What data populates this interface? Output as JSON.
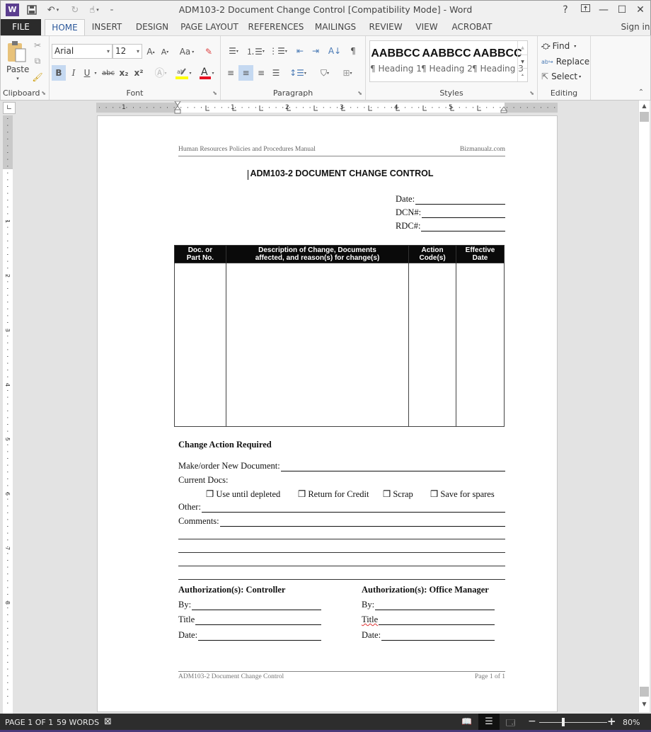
{
  "window": {
    "title": "ADM103-2 Document Change Control [Compatibility Mode] - Word",
    "controls": {
      "help": "?",
      "ribbon_options": "⊼",
      "minimize": "—",
      "maximize": "☐",
      "close": "✕"
    }
  },
  "quick_access": {
    "app_icon": "W",
    "save_icon": "save-icon",
    "undo_icon": "undo-icon",
    "redo_icon": "redo-icon",
    "touch_mode_icon": "touch-mode-icon",
    "customize_icon": "customize-icon"
  },
  "ribbon_tabs": [
    {
      "label": "FILE"
    },
    {
      "label": "HOME",
      "active": true
    },
    {
      "label": "INSERT"
    },
    {
      "label": "DESIGN"
    },
    {
      "label": "PAGE LAYOUT"
    },
    {
      "label": "REFERENCES"
    },
    {
      "label": "MAILINGS"
    },
    {
      "label": "REVIEW"
    },
    {
      "label": "VIEW"
    },
    {
      "label": "ACROBAT"
    }
  ],
  "sign_in": "Sign in",
  "ribbon": {
    "clipboard": {
      "label": "Clipboard",
      "paste": "Paste"
    },
    "font": {
      "label": "Font",
      "family": "Arial",
      "size": "12",
      "change_case": "Aa",
      "bold": "B",
      "italic": "I",
      "underline": "U",
      "strikethrough": "abc",
      "subscript": "x₂",
      "superscript": "x²",
      "highlight_color": "#ffff00",
      "font_color": "#e81123"
    },
    "paragraph": {
      "label": "Paragraph",
      "pilcrow": "¶"
    },
    "styles": {
      "label": "Styles",
      "items": [
        {
          "preview": "AABBCC",
          "name": "¶ Heading 1"
        },
        {
          "preview": "AABBCC",
          "name": "¶ Heading 2"
        },
        {
          "preview": "AABBCC",
          "name": "¶ Heading 3"
        }
      ]
    },
    "editing": {
      "label": "Editing",
      "find": "Find",
      "replace": "Replace",
      "select": "Select"
    }
  },
  "ruler": {
    "horizontal_numbers": [
      "1",
      "1",
      "2",
      "3",
      "4",
      "5"
    ],
    "vertical_numbers": [
      "1",
      "2",
      "3",
      "4",
      "5",
      "6",
      "7",
      "8"
    ]
  },
  "document": {
    "header_left": "Human Resources Policies and Procedures Manual",
    "header_right": "Bizmanualz.com",
    "title": "ADM103-2 DOCUMENT CHANGE CONTROL",
    "top_fields": [
      "Date:",
      "DCN#:",
      "RDC#:"
    ],
    "table": {
      "headers": [
        [
          "Doc. or",
          "Part No."
        ],
        [
          "Description of Change, Documents",
          "affected, and reason(s) for change(s)"
        ],
        [
          "Action",
          "Code(s)"
        ],
        [
          "Effective",
          "Date"
        ]
      ]
    },
    "change_action": {
      "heading": "Change Action Required",
      "make_order": "Make/order New Document:",
      "current_docs": "Current Docs:",
      "checkboxes": [
        {
          "label": "Use until depleted",
          "checked": false
        },
        {
          "label": "Return for Credit",
          "checked": false
        },
        {
          "label": "Scrap",
          "checked": false
        },
        {
          "label": "Save for spares",
          "checked": false
        }
      ],
      "other": "Other:",
      "comments": "Comments:"
    },
    "authorization": [
      {
        "heading": "Authorization(s): Controller",
        "fields": [
          "By:",
          "Title",
          "Date:"
        ]
      },
      {
        "heading": "Authorization(s): Office Manager",
        "fields": [
          "By:",
          "Title",
          "Date:"
        ]
      }
    ],
    "footer_left": "ADM103-2 Document Change Control",
    "footer_right": "Page 1 of 1"
  },
  "status_bar": {
    "page": "PAGE 1 OF 1",
    "words": "59 WORDS",
    "zoom": "80%",
    "zoom_minus": "−",
    "zoom_plus": "+"
  }
}
